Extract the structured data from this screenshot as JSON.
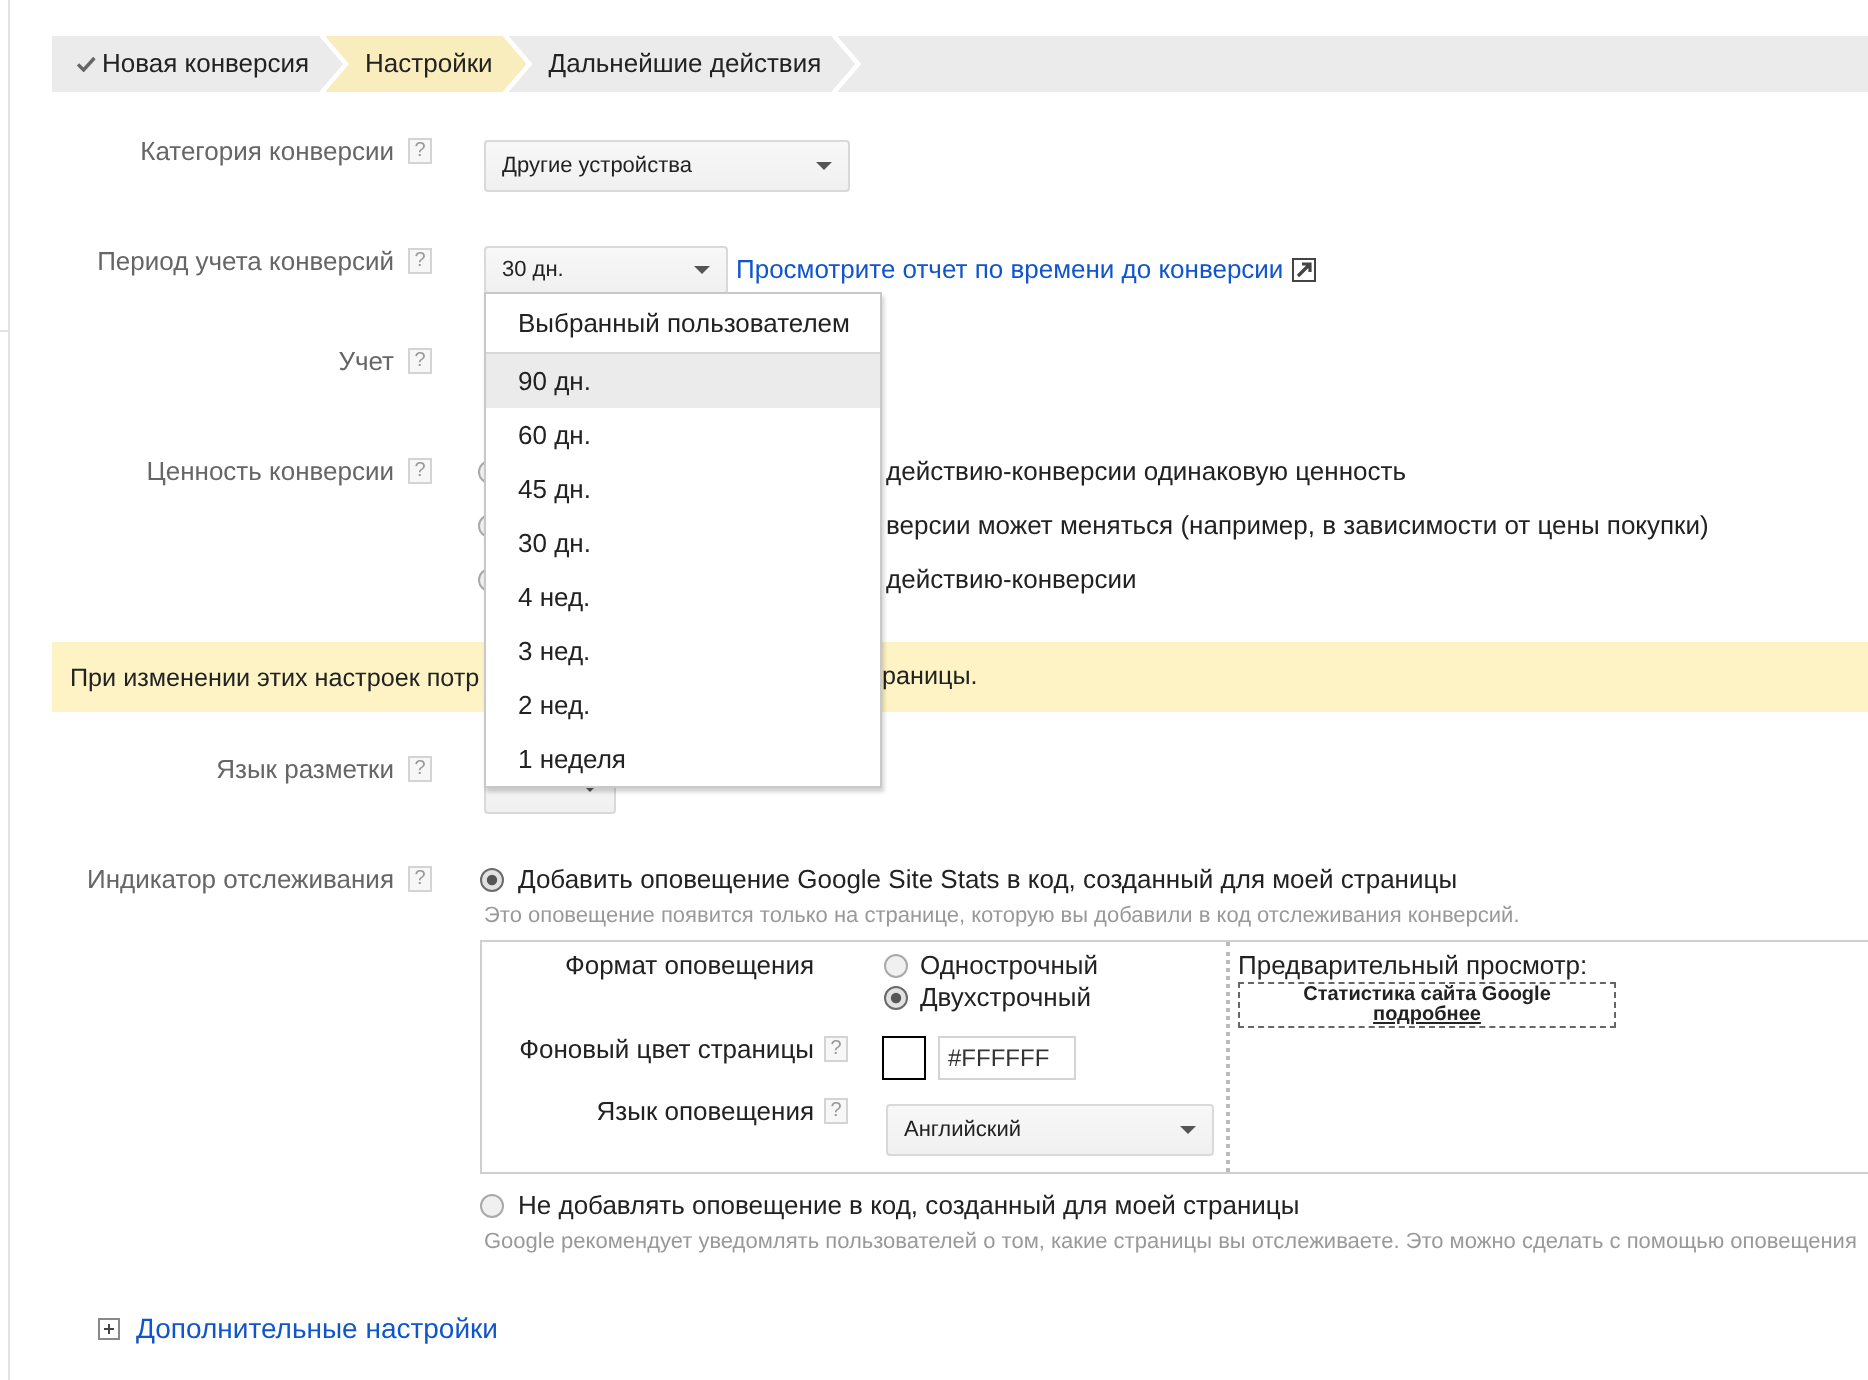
{
  "steps": [
    {
      "label": "Новая конверсия",
      "done": true,
      "selected": false
    },
    {
      "label": "Настройки",
      "done": false,
      "selected": true
    },
    {
      "label": "Дальнейшие действия",
      "done": false,
      "selected": false
    }
  ],
  "category": {
    "label": "Категория конверсии",
    "help": "?",
    "value": "Другие устройства"
  },
  "period": {
    "label": "Период учета конверсий",
    "help": "?",
    "value": "30 дн.",
    "link": "Просмотрите отчет по времени до конверсии",
    "expanded": true,
    "options": [
      {
        "label": "Выбранный пользователем",
        "kind": "custom",
        "highlighted": false
      },
      {
        "label": "90 дн.",
        "kind": "preset",
        "highlighted": true
      },
      {
        "label": "60 дн.",
        "kind": "preset",
        "highlighted": false
      },
      {
        "label": "45 дн.",
        "kind": "preset",
        "highlighted": false
      },
      {
        "label": "30 дн.",
        "kind": "preset",
        "highlighted": false
      },
      {
        "label": "4 нед.",
        "kind": "preset",
        "highlighted": false
      },
      {
        "label": "3 нед.",
        "kind": "preset",
        "highlighted": false
      },
      {
        "label": "2 нед.",
        "kind": "preset",
        "highlighted": false
      },
      {
        "label": "1 неделя",
        "kind": "preset",
        "highlighted": false
      }
    ]
  },
  "counting": {
    "label": "Учет",
    "help": "?"
  },
  "conversion_value": {
    "label": "Ценность конверсии",
    "help": "?",
    "options": [
      {
        "text": "действию-конверсии одинаковую ценность",
        "selected": false
      },
      {
        "text": "версии может меняться (например, в зависимости от цены покупки)",
        "selected": false
      },
      {
        "text": "действию-конверсии",
        "selected": false
      }
    ]
  },
  "notice": {
    "parts": [
      "При изменении этих настроек потр",
      "раницы."
    ]
  },
  "markup_language": {
    "label": "Язык разметки",
    "help": "?"
  },
  "tracking_indicator": {
    "label": "Индикатор отслеживания",
    "help": "?",
    "options": [
      {
        "label": "Добавить оповещение Google Site Stats в код, созданный для моей страницы",
        "hint": "Это оповещение появится только на странице, которую вы добавили в код отслеживания конверсий.",
        "selected": true
      },
      {
        "label": "Не добавлять оповещение в код, созданный для моей страницы",
        "hint": "Google рекомендует уведомлять пользователей о том, какие страницы вы отслеживаете. Это можно сделать с помощью оповещения",
        "selected": false
      }
    ]
  },
  "notice_settings": {
    "format": {
      "label": "Формат оповещения",
      "options": [
        {
          "label": "Однострочный",
          "selected": false
        },
        {
          "label": "Двухстрочный",
          "selected": true
        }
      ]
    },
    "background": {
      "label": "Фоновый цвет страницы",
      "help": "?",
      "value": "#FFFFFF"
    },
    "language": {
      "label": "Язык оповещения",
      "help": "?",
      "value": "Английский"
    },
    "preview": {
      "title": "Предварительный просмотр:",
      "line": "Статистика сайта Google",
      "link": "подробнее"
    }
  },
  "advanced": {
    "label": "Дополнительные настройки",
    "expanded": false
  }
}
